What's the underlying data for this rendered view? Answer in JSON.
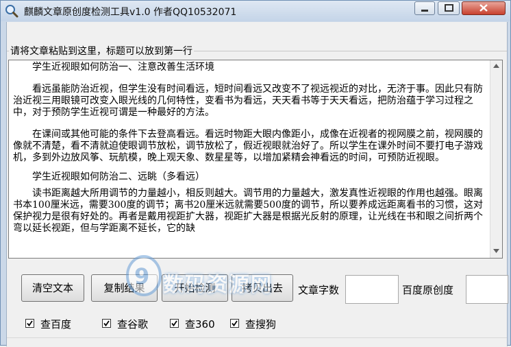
{
  "window": {
    "title": "麒麟文章原创度检测工具v1.0 作者QQ10532071",
    "accent_color": "#cbd8e8"
  },
  "editor": {
    "group_label": "请将文章粘贴到这里，标题可以放到第一行",
    "paragraphs": [
      "学生近视眼如何防治一、注意改善生活环境",
      "看远虽能防治近视，但学生没有时间看远，短时间看远又改变不了视远视近的对比，无济于事。因此只有防治近视三用眼镜可改变入眼光线的几何特性，变看书为看远，天天看书等于天天看远，把防治蕴于学习过程之中，对于预防学生近视可谓是一种最好的方法。",
      "在课间或其他可能的条件下去登高看远。看远时物距大眼内像距小，成像在近视者的视网膜之前，视网膜的像就不清楚，看不清就迫使眼调节放松，调节放松了，假近视眼就治好了。所以学生在课外时间不要打电子游戏机，多到外边放风筝、玩航模，晚上观天象、数星星等，以增加紧精会神看远的时间，可预防近视眼。",
      "学生近视眼如何防治二、远眺（多看远）",
      "读书距离越大所用调节的力量越小，相反则越大。调节用的力量越大，激发真性近视眼的作用也越强。眼离书本100厘米远，需要300度的调节；离书20厘米远就需要500度的调节，所以要养成远距离看书的习惯，这对保护视力是很有好处的。再者是戴用视距扩大器，视距扩大器是根据光反射的原理，让光线在书和眼之间折两个弯以延长视距，但与学距离不延长，它的缺"
    ]
  },
  "toolbar": {
    "clear_label": "清空文本",
    "copy_result_label": "复制结果",
    "start_label": "开始检测",
    "copy_out_label": "拷贝出去",
    "word_count_label": "文章字数",
    "word_count_value": "",
    "baidu_originality_label": "百度原创度",
    "baidu_originality_value": ""
  },
  "options": [
    {
      "label": "查百度",
      "checked": true
    },
    {
      "label": "查谷歌",
      "checked": true
    },
    {
      "label": "查360",
      "checked": true
    },
    {
      "label": "查搜狗",
      "checked": true
    }
  ],
  "watermark": {
    "text": "数码资源网"
  }
}
